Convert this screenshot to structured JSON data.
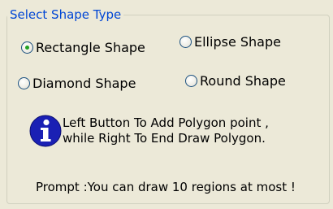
{
  "group": {
    "title": "Select Shape Type"
  },
  "options": [
    {
      "label": "Rectangle Shape",
      "selected": true
    },
    {
      "label": "Ellipse Shape",
      "selected": false
    },
    {
      "label": "Diamond Shape",
      "selected": false
    },
    {
      "label": "Round Shape",
      "selected": false
    }
  ],
  "info": {
    "icon": "info-icon",
    "line1": "Left  Button To Add Polygon point ,",
    "line2": "while Right To End Draw Polygon."
  },
  "prompt": "Prompt :You can draw 10 regions at most !",
  "colors": {
    "title": "#0046d5",
    "background": "#ece9d8",
    "radio_selected_dot": "#21a121",
    "info_icon_fill": "#1a20b4"
  }
}
